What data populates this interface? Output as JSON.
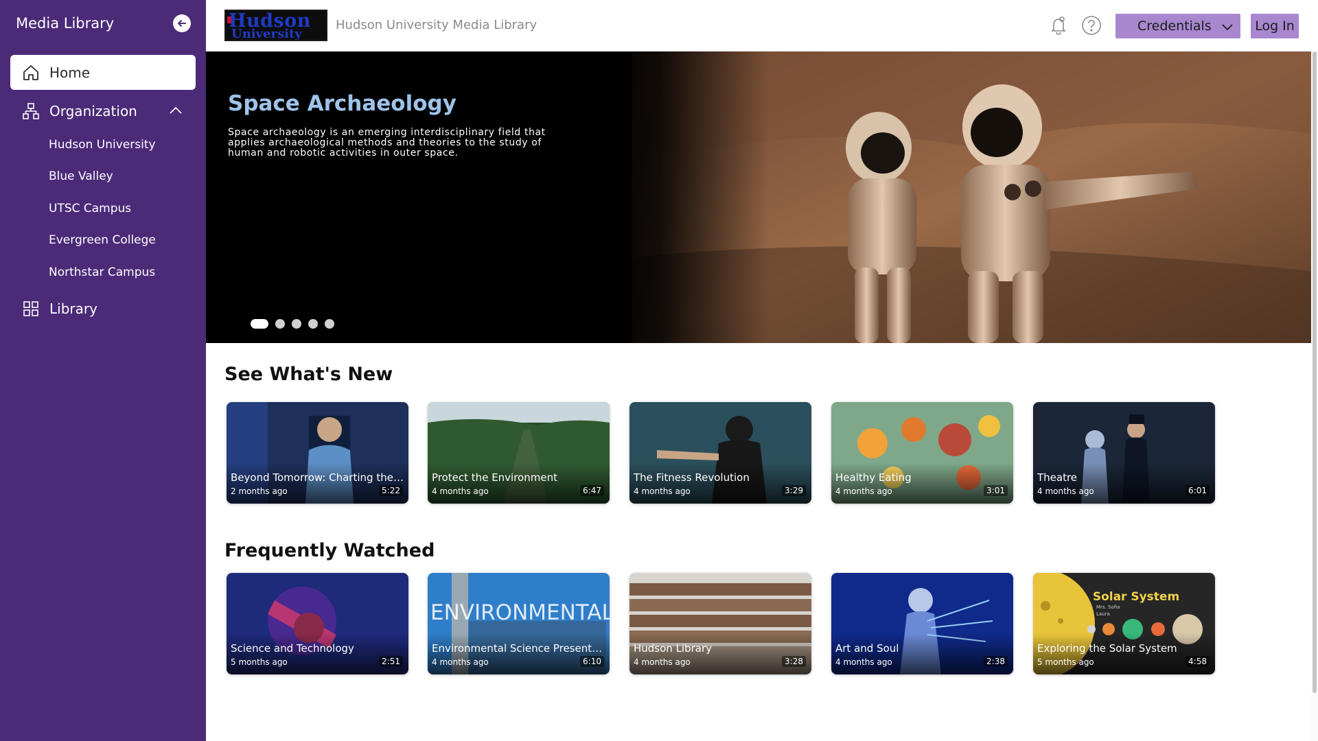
{
  "app": {
    "sidebar_title": "Media Library",
    "site_title": "Hudson University Media Library"
  },
  "logo": {
    "line1": "Hudson",
    "line2": "University"
  },
  "sidebar": {
    "home": "Home",
    "organization": "Organization",
    "organizations": [
      "Hudson University",
      "Blue Valley",
      "UTSC Campus",
      "Evergreen College",
      "Northstar Campus"
    ],
    "library": "Library"
  },
  "topbar": {
    "credentials": "Credentials",
    "login": "Log In"
  },
  "hero": {
    "title": "Space Archaeology",
    "description": "Space archaeology is an emerging interdisciplinary field that applies archaeological methods and theories to the study of human and robotic activities in outer space.",
    "slide_count": 5,
    "active_slide": 1
  },
  "sections": {
    "new": {
      "title": "See What's New",
      "cards": [
        {
          "title": "Beyond Tomorrow: Charting the Fu...",
          "age": "2 months ago",
          "duration": "5:22"
        },
        {
          "title": "Protect the Environment",
          "age": "4 months ago",
          "duration": "6:47"
        },
        {
          "title": "The Fitness Revolution",
          "age": "4 months ago",
          "duration": "3:29"
        },
        {
          "title": "Healthy Eating",
          "age": "4 months ago",
          "duration": "3:01"
        },
        {
          "title": "Theatre",
          "age": "4 months ago",
          "duration": "6:01"
        }
      ]
    },
    "frequent": {
      "title": "Frequently Watched",
      "cards": [
        {
          "title": "Science and Technology",
          "age": "5 months ago",
          "duration": "2:51"
        },
        {
          "title": "Environmental Science Presentation",
          "age": "4 months ago",
          "duration": "6:10",
          "overlay": "ENVIRONMENTAL SCIENCE"
        },
        {
          "title": "Hudson Library",
          "age": "4 months ago",
          "duration": "3:28"
        },
        {
          "title": "Art and Soul",
          "age": "4 months ago",
          "duration": "2:38"
        },
        {
          "title": "Exploring the Solar System",
          "age": "5 months ago",
          "duration": "4:58",
          "overlay": "Solar System",
          "overlay_sub1": "Mrs. Sofia",
          "overlay_sub2": "Laura"
        }
      ]
    }
  },
  "colors": {
    "sidebar": "#4b2a78",
    "accent": "#a887cf",
    "hero_title": "#9ec3ea"
  },
  "icons": [
    "arrow-left-icon",
    "home-icon",
    "org-chart-icon",
    "chevron-up-icon",
    "grid-icon",
    "bell-icon",
    "help-icon",
    "chevron-down-icon"
  ]
}
